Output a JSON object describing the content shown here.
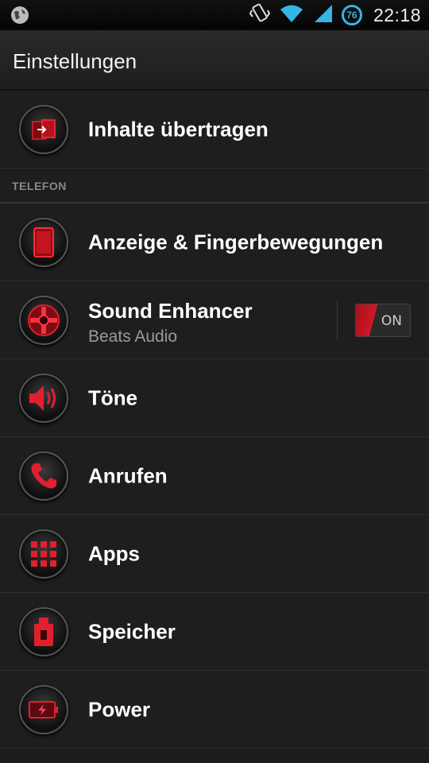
{
  "status_bar": {
    "time": "22:18",
    "battery_level": "76",
    "icons": [
      "globe-icon",
      "vibrate-icon",
      "wifi-icon",
      "signal-icon",
      "battery-icon"
    ]
  },
  "action_bar": {
    "title": "Einstellungen"
  },
  "sections": {
    "telefon": "TELEFON"
  },
  "items": [
    {
      "label": "Inhalte übertragen",
      "icon": "transfer-icon"
    },
    {
      "label": "Anzeige & Fingerbewegungen",
      "icon": "display-icon"
    },
    {
      "label": "Sound Enhancer",
      "sublabel": "Beats Audio",
      "icon": "sound-enhancer-icon",
      "toggle": "ON"
    },
    {
      "label": "Töne",
      "icon": "speaker-icon"
    },
    {
      "label": "Anrufen",
      "icon": "phone-icon"
    },
    {
      "label": "Apps",
      "icon": "apps-grid-icon"
    },
    {
      "label": "Speicher",
      "icon": "storage-icon"
    },
    {
      "label": "Power",
      "icon": "battery-power-icon"
    }
  ],
  "colors": {
    "accent": "#d01828",
    "status_blue": "#33b5e5",
    "background": "#1e1e1e"
  }
}
